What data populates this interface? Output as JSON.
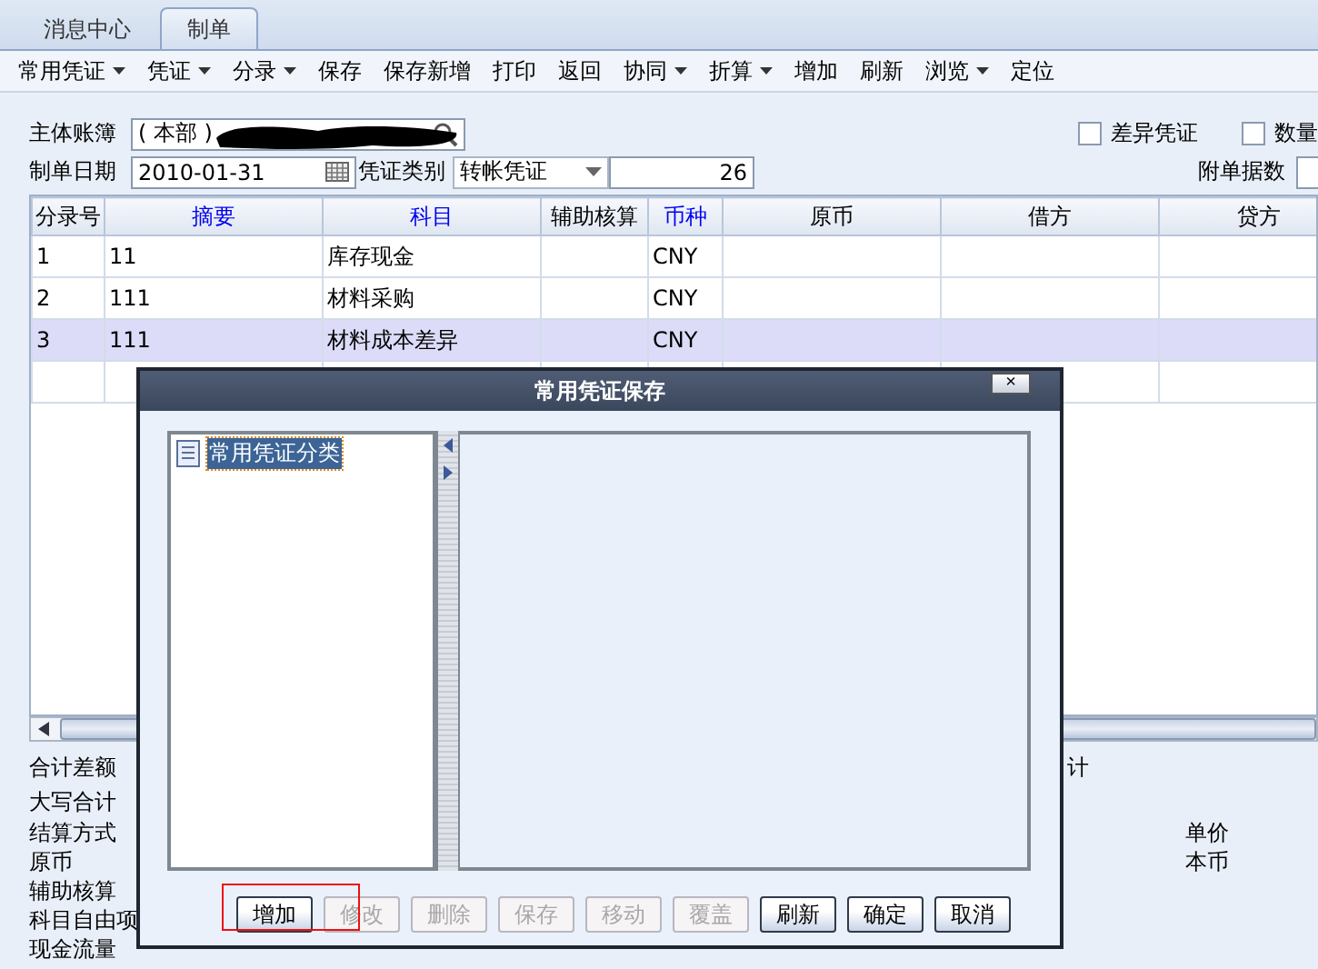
{
  "tabs": [
    {
      "label": "消息中心",
      "selected": false
    },
    {
      "label": "制单",
      "selected": true
    }
  ],
  "toolbar": [
    {
      "label": "常用凭证",
      "dropdown": true
    },
    {
      "label": "凭证",
      "dropdown": true
    },
    {
      "label": "分录",
      "dropdown": true
    },
    {
      "label": "保存",
      "dropdown": false
    },
    {
      "label": "保存新增",
      "dropdown": false
    },
    {
      "label": "打印",
      "dropdown": false
    },
    {
      "label": "返回",
      "dropdown": false
    },
    {
      "label": "协同",
      "dropdown": true
    },
    {
      "label": "折算",
      "dropdown": true
    },
    {
      "label": "增加",
      "dropdown": false
    },
    {
      "label": "刷新",
      "dropdown": false
    },
    {
      "label": "浏览",
      "dropdown": true
    },
    {
      "label": "定位",
      "dropdown": false
    }
  ],
  "form": {
    "account": {
      "label": "主体账簿",
      "value": "( 本部 )",
      "redacted": true
    },
    "date": {
      "label": "制单日期",
      "value": "2010-01-31"
    },
    "voucher_type": {
      "label": "凭证类别",
      "value": "转帐凭证"
    },
    "voucher_number": {
      "value": "26"
    },
    "attachments": {
      "label": "附单据数"
    },
    "checkboxes": [
      {
        "label": "差异凭证",
        "checked": false
      },
      {
        "label": "数量",
        "checked": false
      }
    ]
  },
  "grid": {
    "columns": [
      {
        "label": "分录号",
        "required": false
      },
      {
        "label": "摘要",
        "required": true
      },
      {
        "label": "科目",
        "required": true
      },
      {
        "label": "辅助核算",
        "required": false
      },
      {
        "label": "币种",
        "required": true
      },
      {
        "label": "原币",
        "required": false
      },
      {
        "label": "借方",
        "required": false
      },
      {
        "label": "贷方",
        "required": false
      }
    ],
    "rows": [
      {
        "cells": [
          "1",
          "11",
          "库存现金",
          null,
          "CNY",
          null,
          null,
          null
        ],
        "selected": false
      },
      {
        "cells": [
          "2",
          "111",
          "材料采购",
          null,
          "CNY",
          null,
          null,
          null
        ],
        "selected": false
      },
      {
        "cells": [
          "3",
          "111",
          "材料成本差异",
          null,
          "CNY",
          null,
          null,
          null
        ],
        "selected": true
      }
    ]
  },
  "footer": {
    "total_label": "合计差额",
    "total_fragment": "计",
    "uppercase_label": "大写合计",
    "left_labels": [
      "结算方式",
      "原币",
      "辅助核算",
      "科目自由项",
      "现金流量"
    ],
    "right_labels": [
      "单价",
      "本币"
    ]
  },
  "dialog": {
    "title": "常用凭证保存",
    "close": "×",
    "tree": [
      {
        "label": "常用凭证分类",
        "selected": true
      }
    ],
    "buttons": [
      {
        "label": "增加",
        "disabled": false,
        "annotated": true
      },
      {
        "label": "修改",
        "disabled": true,
        "annotated": false
      },
      {
        "label": "删除",
        "disabled": true,
        "annotated": false
      },
      {
        "label": "保存",
        "disabled": true,
        "annotated": false
      },
      {
        "label": "移动",
        "disabled": true,
        "annotated": false
      },
      {
        "label": "覆盖",
        "disabled": true,
        "annotated": false
      },
      {
        "label": "刷新",
        "disabled": false,
        "annotated": false
      },
      {
        "label": "确定",
        "disabled": false,
        "annotated": false
      },
      {
        "label": "取消",
        "disabled": false,
        "annotated": false
      }
    ]
  }
}
